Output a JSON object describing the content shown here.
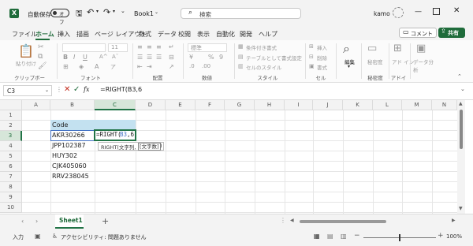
{
  "titlebar": {
    "autosave_label": "自動保存",
    "autosave_state": "オフ",
    "book_title": "Book1",
    "search_placeholder": "検索",
    "user_name": "kamo"
  },
  "menu": {
    "items": [
      "ファイル",
      "ホーム",
      "挿入",
      "描画",
      "ページ レイアウト",
      "数式",
      "データ",
      "校閲",
      "表示",
      "自動化",
      "開発",
      "ヘルプ"
    ],
    "active_index": 1,
    "comment_label": "コメント",
    "share_label": "共有"
  },
  "ribbon": {
    "groups": [
      "クリップボード",
      "フォント",
      "配置",
      "数値",
      "スタイル",
      "セル",
      "編集",
      "秘密度",
      "アドイン"
    ],
    "paste_label": "貼り付け",
    "font_size": "11",
    "number_format": "標準",
    "cond_format": "条件付き書式",
    "table_format": "テーブルとして書式設定",
    "cell_style": "セルのスタイル",
    "insert": "挿入",
    "delete": "削除",
    "format": "書式",
    "edit_label": "編集",
    "sensitivity_label": "秘密度",
    "addin_label": "アド イン",
    "data_analysis": "データ分析"
  },
  "formula_bar": {
    "name_box": "C3",
    "fx": "fx",
    "content": "=RIGHT(B3,6"
  },
  "sheet": {
    "columns": [
      "A",
      "B",
      "C",
      "D",
      "E",
      "F",
      "G",
      "H",
      "I",
      "J",
      "K",
      "L",
      "M",
      "N"
    ],
    "rows": [
      "1",
      "2",
      "3",
      "4",
      "5",
      "6",
      "7",
      "8",
      "9",
      "10"
    ],
    "header_cell": "Code",
    "b_values": [
      "AKR30266",
      "JPP102387",
      "HUY302",
      "CJK405060",
      "RRV238045"
    ],
    "edit_prefix": "=RIGHT(",
    "edit_ref": "B3",
    "edit_suffix": ",6",
    "tooltip_func": "RIGHT(文字列, ",
    "tooltip_arg": "[文字数]",
    "tooltip_close": ")"
  },
  "tabs": {
    "sheet_name": "Sheet1",
    "add": "+"
  },
  "status": {
    "mode": "入力",
    "accessibility": "アクセシビリティ: 問題ありません",
    "zoom": "100%"
  },
  "colors": {
    "excel_green": "#1e6b3a",
    "select_green": "#217346",
    "ref_blue": "#4472c4"
  }
}
